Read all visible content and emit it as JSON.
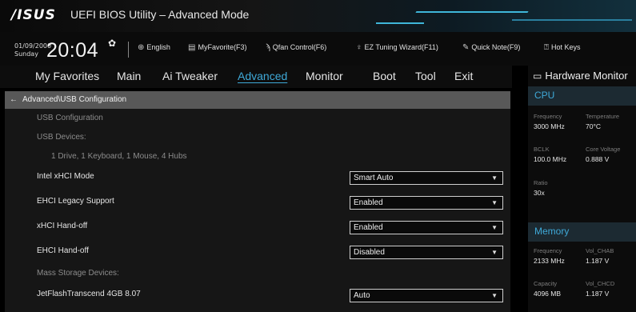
{
  "window": {
    "logo": "/ISUS",
    "title": "UEFI BIOS Utility – Advanced Mode"
  },
  "infobar": {
    "date": "01/09/2000",
    "day": "Sunday",
    "time": "20:04",
    "tools": [
      {
        "icon": "globe-icon",
        "label": "English"
      },
      {
        "icon": "favorite-icon",
        "label": "MyFavorite(F3)"
      },
      {
        "icon": "fan-icon",
        "label": "Qfan Control(F6)"
      },
      {
        "icon": "bulb-icon",
        "label": "EZ Tuning Wizard(F11)"
      },
      {
        "icon": "note-icon",
        "label": "Quick Note(F9)"
      },
      {
        "icon": "help-icon",
        "label": "Hot Keys"
      }
    ]
  },
  "tabs": [
    "My Favorites",
    "Main",
    "Ai Tweaker",
    "Advanced",
    "Monitor",
    "Boot",
    "Tool",
    "Exit"
  ],
  "active_tab": "Advanced",
  "breadcrumb": "Advanced\\USB Configuration",
  "content": {
    "section_title": "USB Configuration",
    "usb_devices_label": "USB Devices:",
    "usb_devices_value": "1 Drive, 1 Keyboard, 1 Mouse, 4 Hubs",
    "settings": [
      {
        "label": "Intel xHCI Mode",
        "value": "Smart Auto"
      },
      {
        "label": "EHCI Legacy Support",
        "value": "Enabled"
      },
      {
        "label": "xHCI Hand-off",
        "value": "Enabled"
      },
      {
        "label": "EHCI Hand-off",
        "value": "Disabled"
      }
    ],
    "mass_storage_label": "Mass Storage Devices:",
    "mass_storage": [
      {
        "label": "JetFlashTranscend 4GB 8.07",
        "value": "Auto"
      }
    ]
  },
  "hardware_monitor": {
    "title": "Hardware Monitor",
    "cpu": {
      "title": "CPU",
      "frequency_label": "Frequency",
      "frequency": "3000 MHz",
      "temperature_label": "Temperature",
      "temperature": "70°C",
      "bclk_label": "BCLK",
      "bclk": "100.0 MHz",
      "core_voltage_label": "Core Voltage",
      "core_voltage": "0.888 V",
      "ratio_label": "Ratio",
      "ratio": "30x"
    },
    "memory": {
      "title": "Memory",
      "frequency_label": "Frequency",
      "frequency": "2133 MHz",
      "vol_chab_label": "Vol_CHAB",
      "vol_chab": "1.187 V",
      "capacity_label": "Capacity",
      "capacity": "4096 MB",
      "vol_chcd_label": "Vol_CHCD",
      "vol_chcd": "1.187 V"
    }
  },
  "colors": {
    "accent": "#3fa9d8",
    "breadcrumb_bg": "#585858",
    "panel_bg": "#161616"
  }
}
